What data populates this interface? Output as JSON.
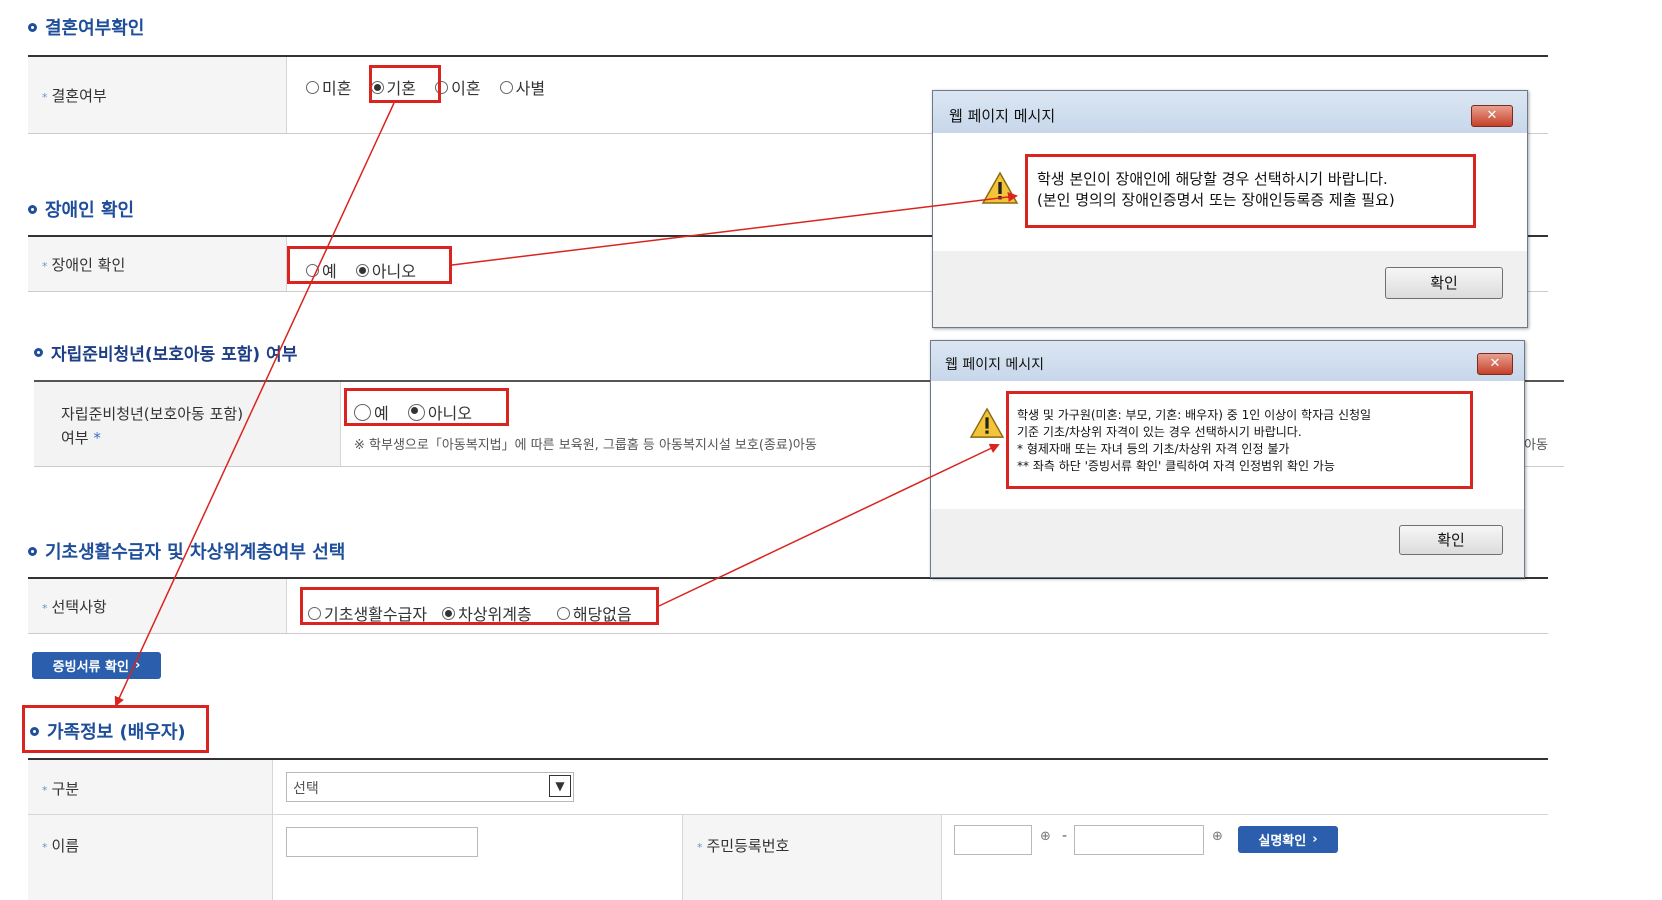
{
  "sections": {
    "marriage": {
      "title": "결혼여부확인",
      "label": "결혼여부",
      "options": [
        "미혼",
        "기혼",
        "이혼",
        "사별"
      ],
      "selected": "기혼"
    },
    "disabled": {
      "title": "장애인 확인",
      "label": "장애인 확인",
      "options": [
        "예",
        "아니오"
      ],
      "selected": "아니오"
    },
    "independent": {
      "title": "자립준비청년(보호아동 포함) 여부",
      "label_line1": "자립준비청년(보호아동 포함)",
      "label_line2": "여부",
      "options": [
        "예",
        "아니오"
      ],
      "selected": "아니오",
      "note": "※ 학부생으로「아동복지법」에 따른 보육원, 그룹홈 등 아동복지시설 보호(종료)아동",
      "note_tail": "아동"
    },
    "basic_living": {
      "title": "기초생활수급자 및 차상위계층여부 선택",
      "label": "선택사항",
      "options": [
        "기초생활수급자",
        "차상위계층",
        "해당없음"
      ],
      "selected": "차상위계층"
    },
    "family": {
      "title": "가족정보 (배우자)",
      "category_label": "구분",
      "category_value": "선택",
      "name_label": "이름",
      "rrn_label": "주민등록번호",
      "rrn_dash": "-"
    }
  },
  "buttons": {
    "documents": "증빙서류 확인",
    "verify_name": "실명확인"
  },
  "dialog1": {
    "title": "웹 페이지 메시지",
    "close": "✕",
    "line1": "학생 본인이 장애인에 해당할 경우 선택하시기 바랍니다.",
    "line2": "(본인 명의의 장애인증명서 또는 장애인등록증 제출 필요)",
    "ok": "확인"
  },
  "dialog2": {
    "title": "웹 페이지 메시지",
    "close": "✕",
    "line1": "학생 및 가구원(미혼: 부모, 기혼: 배우자) 중 1인 이상이 학자금 신청일",
    "line2": "기준 기초/차상위 자격이 있는 경우 선택하시기 바랍니다.",
    "line3": "* 형제자매 또는 자녀 등의 기초/차상위 자격 인정 불가",
    "line4": "** 좌측 하단 '증빙서류 확인' 클릭하여 자격 인정범위 확인 가능",
    "ok": "확인"
  },
  "colors": {
    "section_title": "#1f4e9a",
    "highlight": "#d9241f",
    "label_bg": "#f5f5f5",
    "button_blue": "#2b5fae"
  },
  "icons": [
    "warning-icon",
    "close-icon",
    "dropdown-arrow-icon",
    "key-icon",
    "chevron-right-icon"
  ]
}
